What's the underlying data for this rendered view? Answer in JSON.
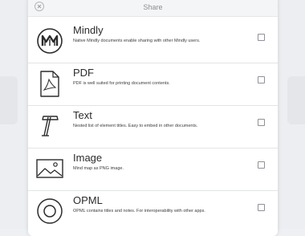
{
  "dialog": {
    "title": "Share",
    "close_icon": "close-icon"
  },
  "options": [
    {
      "id": "mindly",
      "title": "Mindly",
      "description": "Native Mindly documents enable sharing with other Mindly users.",
      "icon": "mindly-logo-icon",
      "checked": false
    },
    {
      "id": "pdf",
      "title": "PDF",
      "description": "PDF is well suited for printing document contents.",
      "icon": "pdf-file-icon",
      "checked": false
    },
    {
      "id": "text",
      "title": "Text",
      "description": "Nested list of element titles. Easy to embed in other documents.",
      "icon": "text-t-icon",
      "checked": false
    },
    {
      "id": "image",
      "title": "Image",
      "description": "Mind map as PNG image.",
      "icon": "image-icon",
      "checked": false
    },
    {
      "id": "opml",
      "title": "OPML",
      "description": "OPML contains titles and notes. For interoperability with other apps.",
      "icon": "opml-circle-icon",
      "checked": false
    }
  ],
  "colors": {
    "icon_stroke": "#2b2b2b",
    "checkbox_border": "#8e9196",
    "header_bg": "#f4f5f6"
  }
}
